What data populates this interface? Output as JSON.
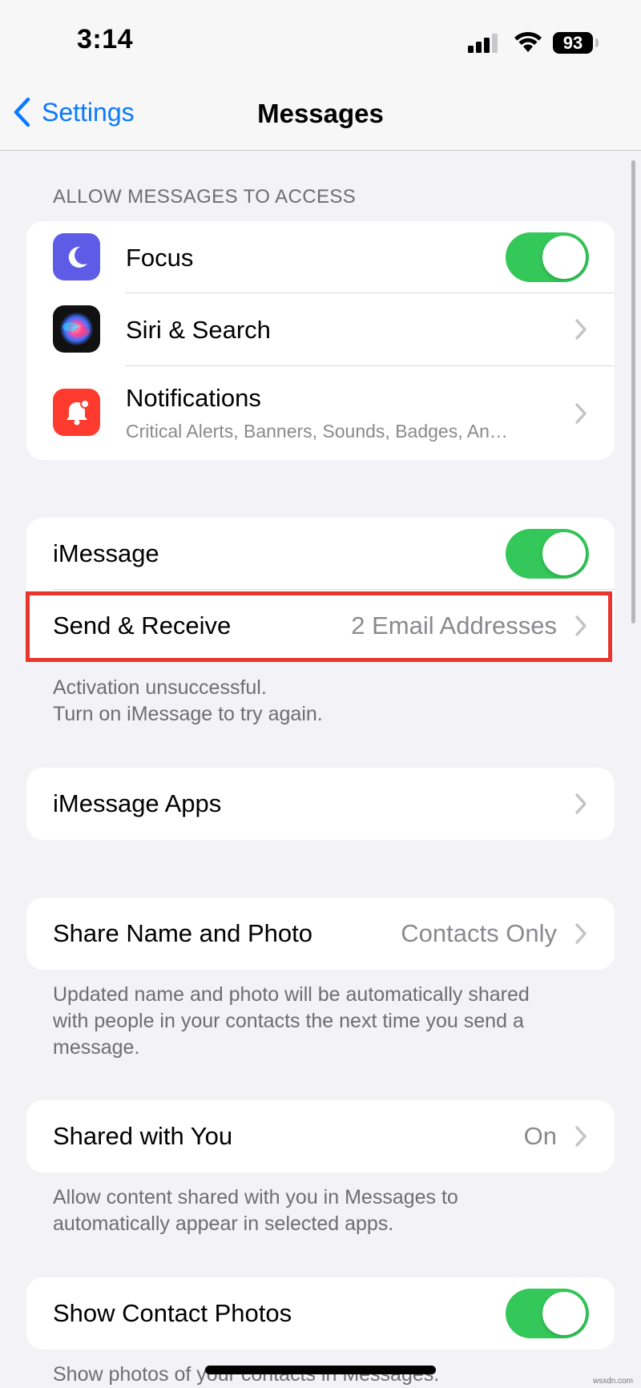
{
  "status_bar": {
    "time": "3:14",
    "battery": "93"
  },
  "nav": {
    "back_label": "Settings",
    "title": "Messages"
  },
  "allow_section": {
    "header": "ALLOW MESSAGES TO ACCESS",
    "items": [
      {
        "label": "Focus",
        "toggle": "on",
        "icon": "moon-icon",
        "icon_color": "#5e5ce6"
      },
      {
        "label": "Siri & Search",
        "icon": "siri-icon"
      },
      {
        "label": "Notifications",
        "subtitle": "Critical Alerts, Banners, Sounds, Badges, An…",
        "icon": "bell-icon",
        "icon_color": "#ff3b30"
      }
    ]
  },
  "imessage_section": {
    "imessage_label": "iMessage",
    "imessage_toggle": "on",
    "send_receive_label": "Send & Receive",
    "send_receive_value": "2 Email Addresses",
    "footer_line1": "Activation unsuccessful.",
    "footer_line2": "Turn on iMessage to try again."
  },
  "apps_section": {
    "label": "iMessage Apps"
  },
  "share_section": {
    "label": "Share Name and Photo",
    "value": "Contacts Only",
    "footer_line1": "Updated name and photo will be automatically shared",
    "footer_line2": "with people in your contacts the next time you send a",
    "footer_line3": "message."
  },
  "shared_section": {
    "label": "Shared with You",
    "value": "On",
    "footer_line1": "Allow content shared with you in Messages to",
    "footer_line2": "automatically appear in selected apps."
  },
  "contact_photos_section": {
    "label": "Show Contact Photos",
    "toggle": "on",
    "footer": "Show photos of your contacts in Messages."
  },
  "watermark": "wsxdn.com",
  "colors": {
    "accent": "#0a7aff",
    "toggle_on": "#34c759",
    "highlight": "#e8362f"
  }
}
